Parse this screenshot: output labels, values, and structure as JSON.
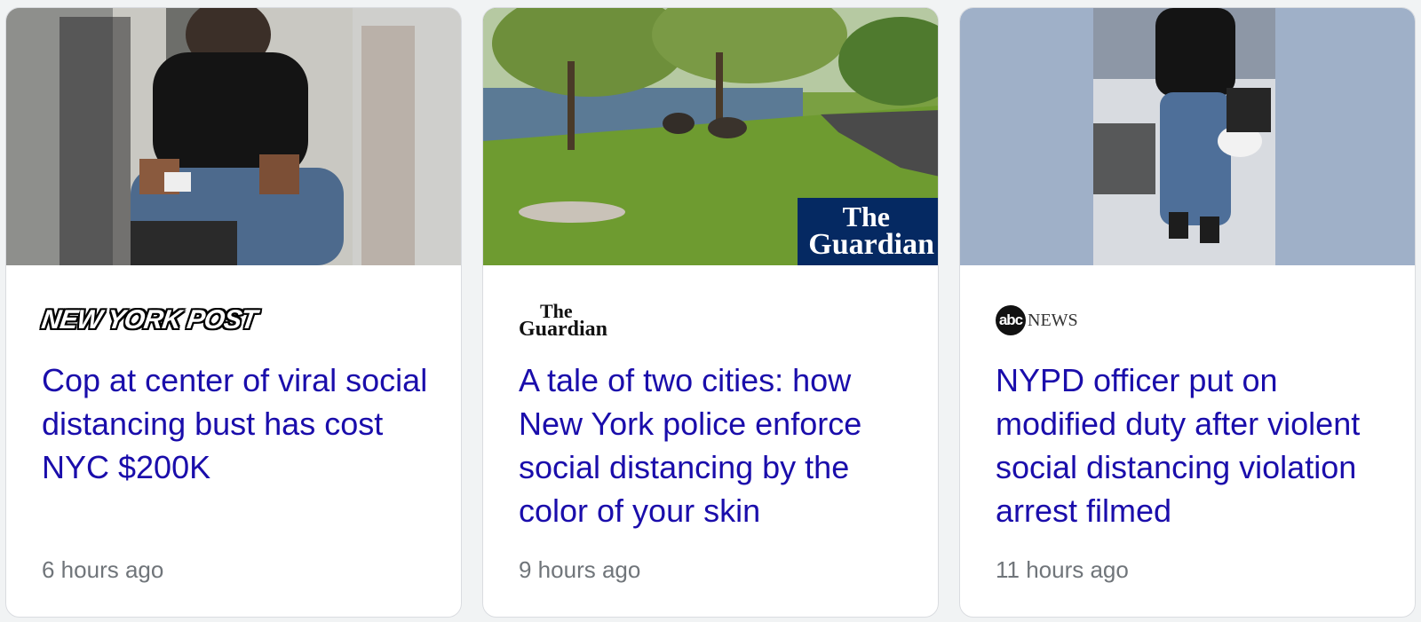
{
  "cards": [
    {
      "source": "NEW YORK POST",
      "headline": "Cop at center of viral social distancing bust has cost NYC $200K",
      "time": "6 hours ago"
    },
    {
      "source_line1": "The",
      "source_line2": "Guardian",
      "image_badge_line1": "The",
      "image_badge_line2": "Guardian",
      "headline": "A tale of two cities: how New York police enforce social distancing by the color of your skin",
      "time": "9 hours ago"
    },
    {
      "source_mark": "abc",
      "source_text": "NEWS",
      "headline": "NYPD officer put on modified duty after violent social distancing violation arrest filmed",
      "time": "11 hours ago"
    }
  ],
  "colors": {
    "headline": "#1a0dab",
    "timestamp": "#70757a",
    "card_border": "#dadce0",
    "guardian_blue": "#052962"
  }
}
